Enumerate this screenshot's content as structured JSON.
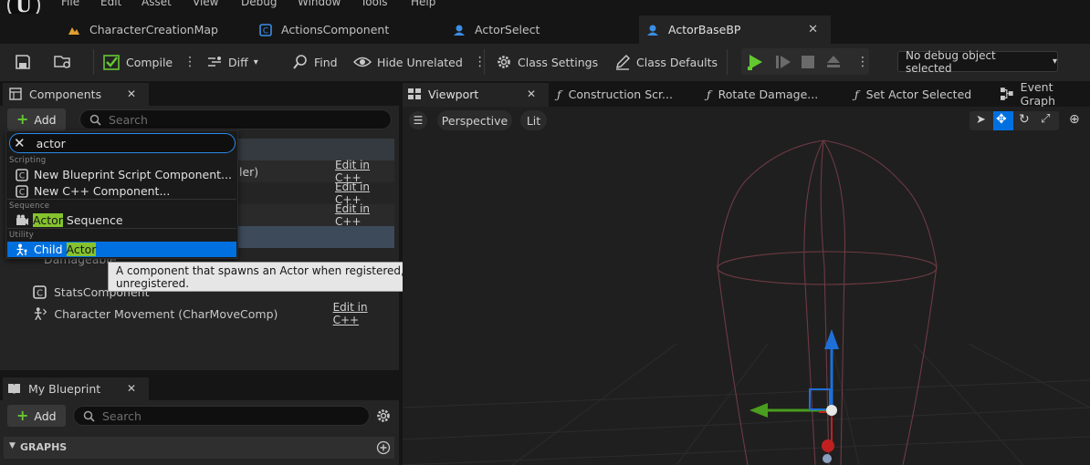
{
  "menu": [
    "File",
    "Edit",
    "Asset",
    "View",
    "Debug",
    "Window",
    "Tools",
    "Help"
  ],
  "tabs": [
    {
      "label": "CharacterCreationMap",
      "icon": "map-icon"
    },
    {
      "label": "ActionsComponent",
      "icon": "class-icon"
    },
    {
      "label": "ActorSelect",
      "icon": "actor-icon"
    },
    {
      "label": "ActorBaseBP",
      "icon": "actor-icon",
      "active": true,
      "close": "✕"
    }
  ],
  "toolbar": {
    "compile": "Compile",
    "diff": "Diff",
    "find": "Find",
    "hide_unrelated": "Hide Unrelated",
    "class_settings": "Class Settings",
    "class_defaults": "Class Defaults",
    "debug_object": "No debug object selected"
  },
  "components": {
    "tab_label": "Components",
    "close": "✕",
    "add_label": "Add",
    "search_placeholder": "Search",
    "rows": [
      {
        "label": "ler)",
        "edit": "Edit in C++"
      },
      {
        "label": "",
        "edit": "Edit in C++"
      },
      {
        "label": "",
        "edit": "Edit in C++"
      },
      {
        "label": "DamageableC...",
        "edit": ""
      },
      {
        "label": "StatsComponent",
        "edit": ""
      },
      {
        "label": "Character Movement (CharMoveComp)",
        "edit": "Edit in C++"
      }
    ]
  },
  "dropdown": {
    "query": "actor",
    "categories": {
      "scripting": "Scripting",
      "sequence": "Sequence",
      "utility": "Utility"
    },
    "items": {
      "new_bp": "New Blueprint Script Component...",
      "new_cpp": "New C++ Component...",
      "seq_hl": "Actor",
      "seq_rest": " Sequence",
      "child_pre": "Child ",
      "child_hl": "Actor"
    }
  },
  "tooltip": "A component that spawns an Actor when registered, and destroys it when unregistered.",
  "my_blueprint": {
    "tab_label": "My Blueprint",
    "close": "✕",
    "add_label": "Add",
    "search_placeholder": "Search",
    "graphs": "GRAPHS"
  },
  "viewport_tabs": [
    {
      "label": "Viewport",
      "close": "✕"
    },
    {
      "label": "Construction Scr..."
    },
    {
      "label": "Rotate Damage..."
    },
    {
      "label": "Set Actor Selected"
    },
    {
      "label": "Event Graph"
    }
  ],
  "viewport": {
    "perspective": "Perspective",
    "lit": "Lit"
  },
  "colors": {
    "accent": "#2a8ae8",
    "highlight": "#85c32e",
    "play": "#64c832",
    "selection": "#0070e0"
  }
}
